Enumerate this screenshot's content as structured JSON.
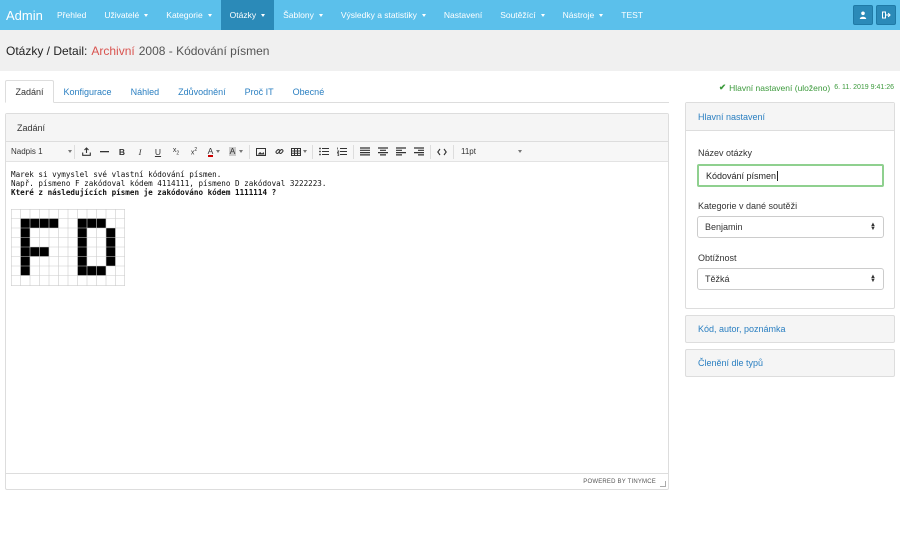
{
  "nav": {
    "brand": "Admin",
    "items": [
      {
        "label": "Přehled",
        "dropdown": false,
        "active": false
      },
      {
        "label": "Uživatelé",
        "dropdown": true,
        "active": false
      },
      {
        "label": "Kategorie",
        "dropdown": true,
        "active": false
      },
      {
        "label": "Otázky",
        "dropdown": true,
        "active": true
      },
      {
        "label": "Šablony",
        "dropdown": true,
        "active": false
      },
      {
        "label": "Výsledky a statistiky",
        "dropdown": true,
        "active": false
      },
      {
        "label": "Nastavení",
        "dropdown": false,
        "active": false
      },
      {
        "label": "Soutěžící",
        "dropdown": true,
        "active": false
      },
      {
        "label": "Nástroje",
        "dropdown": true,
        "active": false
      },
      {
        "label": "TEST",
        "dropdown": false,
        "active": false
      }
    ],
    "right_icons": [
      "user-icon",
      "logout-icon"
    ]
  },
  "header": {
    "breadcrumb": "Otázky / Detail:",
    "archived": "Archivní",
    "rest": "2008 - Kódování písmen"
  },
  "tabs": [
    {
      "label": "Zadání",
      "active": true
    },
    {
      "label": "Konfigurace",
      "active": false
    },
    {
      "label": "Náhled",
      "active": false
    },
    {
      "label": "Zdůvodnění",
      "active": false
    },
    {
      "label": "Proč IT",
      "active": false
    },
    {
      "label": "Obecné",
      "active": false
    }
  ],
  "editor": {
    "panel_title": "Zadání",
    "format_select": "Nadpis 1",
    "font_size_select": "11pt",
    "lines": [
      "Marek si vymyslel své vlastní kódování písmen.",
      "Např. písmeno F zakódoval kódem 4114111, písmeno D zakódoval 3222223."
    ],
    "bold_line": "Které z následujících písmen je zakódováno kódem 1111114 ?",
    "powered_by": "POWERED BY TINYMCE",
    "image_letters": "FD"
  },
  "saved": {
    "message": "Hlavní nastavení (uloženo)",
    "timestamp": "6. 11. 2019 9:41:26"
  },
  "settings": {
    "title": "Hlavní nastavení",
    "name_label": "Název otázky",
    "name_value": "Kódování písmen",
    "category_label": "Kategorie v dané soutěži",
    "category_value": "Benjamin",
    "difficulty_label": "Obtížnost",
    "difficulty_value": "Těžká"
  },
  "collapsed_panels": [
    "Kód, autor, poznámka",
    "Členění dle typů"
  ],
  "colors": {
    "nav_bg": "#5bc0eb",
    "nav_active": "#2b8ab8",
    "archived": "#d9534f",
    "saved": "#3c9a3c",
    "link": "#2a7fc1"
  }
}
